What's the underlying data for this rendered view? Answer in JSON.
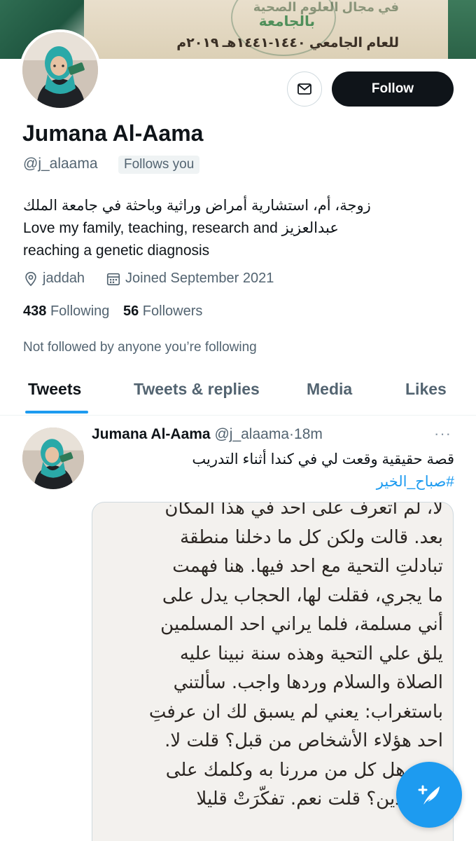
{
  "banner": {
    "line1": "في مجال العلوم الصحية",
    "line2": "بالجامعة",
    "line3": "للعام الجامعي ١٤٤٠-١٤٤١هـ ٢٠١٩م"
  },
  "profile": {
    "name": "Jumana Al-Aama",
    "handle": "@j_alaama",
    "follows_you": "Follows you",
    "bio_line1": "زوجة، أم، استشارية أمراض وراثية وباحثة في جامعة الملك",
    "bio_line2": "Love my family, teaching, research and عبدالعزيز",
    "bio_line3": "reaching a genetic diagnosis",
    "location": "jaddah",
    "joined": "Joined September 2021",
    "following_count": "438",
    "following_label": "Following",
    "followers_count": "56",
    "followers_label": "Followers",
    "not_followed": "Not followed by anyone you’re following"
  },
  "actions": {
    "follow_label": "Follow"
  },
  "tabs": [
    {
      "label": "Tweets",
      "active": true
    },
    {
      "label": "Tweets & replies",
      "active": false
    },
    {
      "label": "Media",
      "active": false
    },
    {
      "label": "Likes",
      "active": false
    }
  ],
  "tweet": {
    "name": "Jumana Al-Aama",
    "handle": "@j_alaama",
    "sep": "·",
    "time": "18m",
    "text": "قصة حقيقية وقعت لي في كندا أثناء التدريب",
    "hashtag": "#صباح_الخير",
    "image_lines": [
      "لا، لم اتعرف على احد في هذا المكان",
      "بعد. قالت ولكن كل ما دخلنا منطقة",
      "تبادلتِ التحية مع احد فيها. هنا فهمت",
      "ما يجري، فقلت لها، الحجاب يدل على",
      "أني مسلمة، فلما يراني احد المسلمين",
      "يلق علي التحية وهذه سنة نبينا عليه",
      "الصلاة والسلام وردها واجب. سألتني",
      "باستغراب: يعني لم يسبق لك ان عرفتِ",
      "احد هؤلاء الأشخاص من قبل؟ قلت لا.",
      "ت: وهل كل من مررنا به وكلمك على",
      "س الدين؟ قلت نعم. تفكّرَتْ قليلا"
    ]
  },
  "colors": {
    "accent": "#1d9bf0",
    "text": "#0f1419",
    "muted": "#536471",
    "follow_bg": "#0f1419"
  }
}
